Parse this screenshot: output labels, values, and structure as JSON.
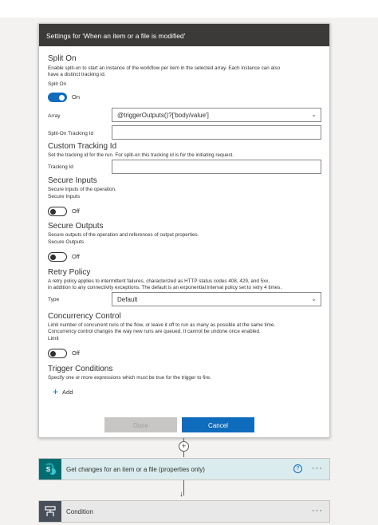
{
  "panel": {
    "title": "Settings for 'When an item or a file is modified'"
  },
  "split_on": {
    "title": "Split On",
    "description_line1": "Enable split-on to start an instance of the workflow per item in the selected array. Each instance can also",
    "description_line2": "have a distinct tracking id.",
    "toggle_label": "Split On",
    "toggle_state": "On",
    "array_label": "Array",
    "array_value": "@triggerOutputs()?['body/value']",
    "tracking_label": "Split-On Tracking Id",
    "tracking_value": ""
  },
  "custom_tracking": {
    "title": "Custom Tracking Id",
    "description": "Set the tracking id for the run. For split-on this tracking id is for the initiating request.",
    "field_label": "Tracking Id",
    "field_value": ""
  },
  "secure_inputs": {
    "title": "Secure Inputs",
    "description": "Secure inputs of the operation.",
    "toggle_label": "Secure Inputs",
    "toggle_state": "Off"
  },
  "secure_outputs": {
    "title": "Secure Outputs",
    "description": "Secure outputs of the operation and references of output properties.",
    "toggle_label": "Secure Outputs",
    "toggle_state": "Off"
  },
  "retry_policy": {
    "title": "Retry Policy",
    "description_line1": "A retry policy applies to intermittent failures, characterized as HTTP status codes 408, 429, and 5xx,",
    "description_line2": "in addition to any connectivity exceptions. The default is an exponential interval policy set to retry 4 times.",
    "type_label": "Type",
    "type_value": "Default"
  },
  "concurrency": {
    "title": "Concurrency Control",
    "description_line1": "Limit number of concurrent runs of the flow, or leave it off to run as many as possible at the same time.",
    "description_line2": "Concurrency control changes the way new runs are queued. It cannot be undone once enabled.",
    "toggle_label": "Limit",
    "toggle_state": "Off"
  },
  "trigger_conditions": {
    "title": "Trigger Conditions",
    "description": "Specify one or more expressions which must be true for the trigger to fire.",
    "add_label": "Add"
  },
  "buttons": {
    "done": "Done",
    "cancel": "Cancel"
  },
  "flow": {
    "plus": "+",
    "step1_title": "Get changes for an item or a file (properties only)",
    "step1_icon": "sharepoint-icon",
    "step2_title": "Condition",
    "step2_icon": "condition-icon",
    "more": "···",
    "help": "?"
  },
  "colors": {
    "accent": "#0f6cbd",
    "header": "#3b3a39",
    "sharepoint": "#036c70"
  }
}
